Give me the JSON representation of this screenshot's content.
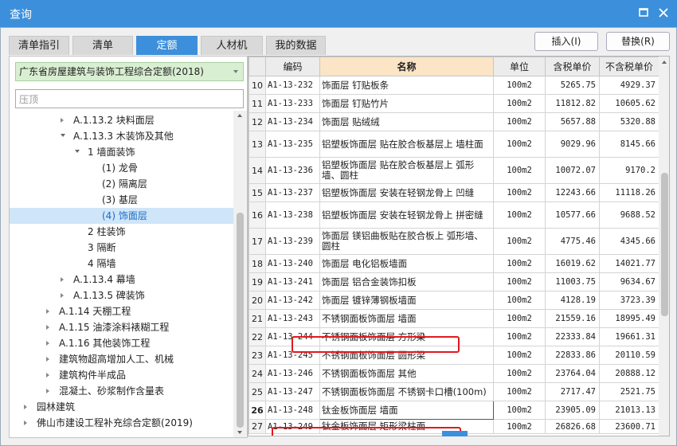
{
  "window": {
    "title": "查询"
  },
  "tabs": [
    {
      "label": "清单指引",
      "active": false
    },
    {
      "label": "清单",
      "active": false
    },
    {
      "label": "定额",
      "active": true
    },
    {
      "label": "人材机",
      "active": false
    },
    {
      "label": "我的数据",
      "active": false
    }
  ],
  "actions": {
    "insert_label": "插入(I)",
    "replace_label": "替换(R)"
  },
  "left": {
    "database_selected": "广东省房屋建筑与装饰工程综合定额(2018)",
    "search_value": "压顶",
    "tree": [
      {
        "label": "A.1.13.2 块料面层",
        "level": 3,
        "expander": "right",
        "selected": false
      },
      {
        "label": "A.1.13.3 木装饰及其他",
        "level": 3,
        "expander": "down",
        "selected": false
      },
      {
        "label": "1 墙面装饰",
        "level": 4,
        "expander": "down",
        "selected": false
      },
      {
        "label": "(1) 龙骨",
        "level": 5,
        "expander": "none",
        "selected": false
      },
      {
        "label": "(2) 隔离层",
        "level": 5,
        "expander": "none",
        "selected": false
      },
      {
        "label": "(3) 基层",
        "level": 5,
        "expander": "none",
        "selected": false
      },
      {
        "label": "(4) 饰面层",
        "level": 5,
        "expander": "none",
        "selected": true
      },
      {
        "label": "2 柱装饰",
        "level": 4,
        "expander": "none",
        "selected": false
      },
      {
        "label": "3 隔断",
        "level": 4,
        "expander": "none",
        "selected": false
      },
      {
        "label": "4 隔墙",
        "level": 4,
        "expander": "none",
        "selected": false
      },
      {
        "label": "A.1.13.4 幕墙",
        "level": 3,
        "expander": "right",
        "selected": false
      },
      {
        "label": "A.1.13.5 碑装饰",
        "level": 3,
        "expander": "right",
        "selected": false
      },
      {
        "label": "A.1.14 天棚工程",
        "level": 2,
        "expander": "right",
        "selected": false
      },
      {
        "label": "A.1.15 油漆涂料裱糊工程",
        "level": 2,
        "expander": "right",
        "selected": false
      },
      {
        "label": "A.1.16 其他装饰工程",
        "level": 2,
        "expander": "right",
        "selected": false
      },
      {
        "label": "建筑物超高增加人工、机械",
        "level": 2,
        "expander": "right",
        "selected": false
      },
      {
        "label": "建筑构件半成品",
        "level": 2,
        "expander": "right",
        "selected": false
      },
      {
        "label": "混凝土、砂浆制作含量表",
        "level": 2,
        "expander": "right",
        "selected": false
      },
      {
        "label": "园林建筑",
        "level": 1,
        "expander": "right",
        "selected": false
      },
      {
        "label": "佛山市建设工程补充综合定额(2019)",
        "level": 1,
        "expander": "right",
        "selected": false
      }
    ]
  },
  "table": {
    "columns": [
      "",
      "编码",
      "名称",
      "单位",
      "含税单价",
      "不含税单价"
    ],
    "rows": [
      {
        "idx": "10",
        "code": "A1-13-232",
        "name": "饰面层 钉贴板条",
        "unit": "100m2",
        "price_tax": "5265.75",
        "price_notax": "4929.37"
      },
      {
        "idx": "11",
        "code": "A1-13-233",
        "name": "饰面层 钉贴竹片",
        "unit": "100m2",
        "price_tax": "11812.82",
        "price_notax": "10605.62"
      },
      {
        "idx": "12",
        "code": "A1-13-234",
        "name": "饰面层 贴绒绒",
        "unit": "100m2",
        "price_tax": "5657.88",
        "price_notax": "5320.88"
      },
      {
        "idx": "13",
        "code": "A1-13-235",
        "name": "铝塑板饰面层 贴在胶合板基层上 墙柱面",
        "unit": "100m2",
        "price_tax": "9029.96",
        "price_notax": "8145.66"
      },
      {
        "idx": "14",
        "code": "A1-13-236",
        "name": "铝塑板饰面层 贴在胶合板基层上 弧形墙、圆柱",
        "unit": "100m2",
        "price_tax": "10072.07",
        "price_notax": "9170.2"
      },
      {
        "idx": "15",
        "code": "A1-13-237",
        "name": "铝塑板饰面层 安装在轻钢龙骨上 凹缝",
        "unit": "100m2",
        "price_tax": "12243.66",
        "price_notax": "11118.26"
      },
      {
        "idx": "16",
        "code": "A1-13-238",
        "name": "铝塑板饰面层 安装在轻钢龙骨上 拼密缝",
        "unit": "100m2",
        "price_tax": "10577.66",
        "price_notax": "9688.52"
      },
      {
        "idx": "17",
        "code": "A1-13-239",
        "name": "饰面层 镁铝曲板贴在胶合板上 弧形墙、圆柱",
        "unit": "100m2",
        "price_tax": "4775.46",
        "price_notax": "4345.66"
      },
      {
        "idx": "18",
        "code": "A1-13-240",
        "name": "饰面层 电化铝板墙面",
        "unit": "100m2",
        "price_tax": "16019.62",
        "price_notax": "14021.77"
      },
      {
        "idx": "19",
        "code": "A1-13-241",
        "name": "饰面层 铝合金装饰扣板",
        "unit": "100m2",
        "price_tax": "11003.75",
        "price_notax": "9634.67"
      },
      {
        "idx": "20",
        "code": "A1-13-242",
        "name": "饰面层 镀锌薄钢板墙面",
        "unit": "100m2",
        "price_tax": "4128.19",
        "price_notax": "3723.39"
      },
      {
        "idx": "21",
        "code": "A1-13-243",
        "name": "不锈钢面板饰面层 墙面",
        "unit": "100m2",
        "price_tax": "21559.16",
        "price_notax": "18995.49"
      },
      {
        "idx": "22",
        "code": "A1-13-244",
        "name": "不锈钢面板饰面层 方形梁",
        "unit": "100m2",
        "price_tax": "22333.84",
        "price_notax": "19661.31"
      },
      {
        "idx": "23",
        "code": "A1-13-245",
        "name": "不锈钢面板饰面层 圆形梁",
        "unit": "100m2",
        "price_tax": "22833.86",
        "price_notax": "20110.59"
      },
      {
        "idx": "24",
        "code": "A1-13-246",
        "name": "不锈钢面板饰面层 其他",
        "unit": "100m2",
        "price_tax": "23764.04",
        "price_notax": "20888.12"
      },
      {
        "idx": "25",
        "code": "A1-13-247",
        "name": "不锈钢面板饰面层 不锈钢卡口槽(100m)",
        "unit": "100m2",
        "price_tax": "2717.47",
        "price_notax": "2521.75"
      },
      {
        "idx": "26",
        "code": "A1-13-248",
        "name": "钛金板饰面层 墙面",
        "unit": "100m2",
        "price_tax": "23905.09",
        "price_notax": "21013.13"
      },
      {
        "idx": "27",
        "code": "A1-13-249",
        "name": "钛金板饰面层 矩形梁柱面",
        "unit": "100m2",
        "price_tax": "26826.68",
        "price_notax": "23600.71"
      }
    ]
  }
}
